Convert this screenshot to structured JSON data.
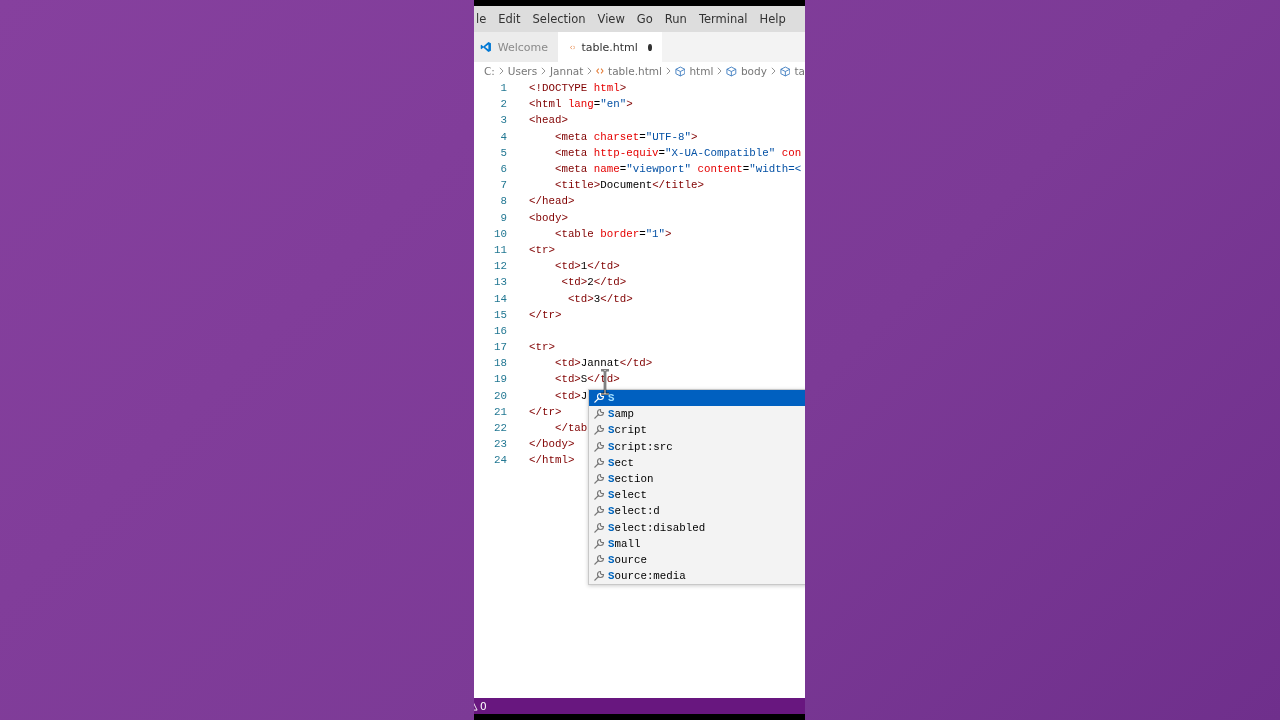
{
  "menu": [
    "le",
    "Edit",
    "Selection",
    "View",
    "Go",
    "Run",
    "Terminal",
    "Help"
  ],
  "tabs": [
    {
      "label": "Welcome",
      "kind": "welcome",
      "selected": false,
      "modified": false
    },
    {
      "label": "table.html",
      "kind": "html",
      "selected": true,
      "modified": true
    }
  ],
  "breadcrumb": [
    {
      "label": "C:",
      "kind": "folder"
    },
    {
      "label": "Users",
      "kind": "folder"
    },
    {
      "label": "Jannat",
      "kind": "folder"
    },
    {
      "label": "table.html",
      "kind": "html"
    },
    {
      "label": "html",
      "kind": "element"
    },
    {
      "label": "body",
      "kind": "element"
    },
    {
      "label": "ta",
      "kind": "element"
    }
  ],
  "editor": {
    "lines": [
      {
        "number": "1",
        "segments": [
          {
            "kind": "tag",
            "text": "<!DOCTYPE"
          },
          {
            "kind": "attr",
            "text": " html"
          },
          {
            "kind": "tag",
            "text": ">"
          }
        ]
      },
      {
        "number": "2",
        "segments": [
          {
            "kind": "tag",
            "text": "<html"
          },
          {
            "kind": "attr",
            "text": " lang"
          },
          {
            "kind": "plain",
            "text": "="
          },
          {
            "kind": "value",
            "text": "\"en\""
          },
          {
            "kind": "tag",
            "text": ">"
          }
        ]
      },
      {
        "number": "3",
        "segments": [
          {
            "kind": "tag",
            "text": "<head>"
          }
        ]
      },
      {
        "number": "4",
        "segments": [
          {
            "kind": "tag",
            "text": "    <meta"
          },
          {
            "kind": "attr",
            "text": " charset"
          },
          {
            "kind": "plain",
            "text": "="
          },
          {
            "kind": "value",
            "text": "\"UTF-8\""
          },
          {
            "kind": "tag",
            "text": ">"
          }
        ]
      },
      {
        "number": "5",
        "segments": [
          {
            "kind": "tag",
            "text": "    <meta"
          },
          {
            "kind": "attr",
            "text": " http-equiv"
          },
          {
            "kind": "plain",
            "text": "="
          },
          {
            "kind": "value",
            "text": "\"X-UA-Compatible\""
          },
          {
            "kind": "attr",
            "text": " con"
          }
        ]
      },
      {
        "number": "6",
        "segments": [
          {
            "kind": "tag",
            "text": "    <meta"
          },
          {
            "kind": "attr",
            "text": " name"
          },
          {
            "kind": "plain",
            "text": "="
          },
          {
            "kind": "value",
            "text": "\"viewport\""
          },
          {
            "kind": "attr",
            "text": " content"
          },
          {
            "kind": "plain",
            "text": "="
          },
          {
            "kind": "value",
            "text": "\"width=<"
          }
        ]
      },
      {
        "number": "7",
        "segments": [
          {
            "kind": "tag",
            "text": "    <title>"
          },
          {
            "kind": "plain",
            "text": "Document"
          },
          {
            "kind": "tag",
            "text": "</title>"
          }
        ]
      },
      {
        "number": "8",
        "segments": [
          {
            "kind": "tag",
            "text": "</head>"
          }
        ]
      },
      {
        "number": "9",
        "segments": [
          {
            "kind": "tag",
            "text": "<body>"
          }
        ]
      },
      {
        "number": "10",
        "segments": [
          {
            "kind": "tag",
            "text": "    <table"
          },
          {
            "kind": "attr",
            "text": " border"
          },
          {
            "kind": "plain",
            "text": "="
          },
          {
            "kind": "value",
            "text": "\"1\""
          },
          {
            "kind": "tag",
            "text": ">"
          }
        ]
      },
      {
        "number": "11",
        "segments": [
          {
            "kind": "tag",
            "text": "<tr>"
          }
        ]
      },
      {
        "number": "12",
        "segments": [
          {
            "kind": "tag",
            "text": "    <td>"
          },
          {
            "kind": "plain",
            "text": "1"
          },
          {
            "kind": "tag",
            "text": "</td>"
          }
        ]
      },
      {
        "number": "13",
        "segments": [
          {
            "kind": "tag",
            "text": "     <td>"
          },
          {
            "kind": "plain",
            "text": "2"
          },
          {
            "kind": "tag",
            "text": "</td>"
          }
        ]
      },
      {
        "number": "14",
        "segments": [
          {
            "kind": "tag",
            "text": "      <td>"
          },
          {
            "kind": "plain",
            "text": "3"
          },
          {
            "kind": "tag",
            "text": "</td>"
          }
        ]
      },
      {
        "number": "15",
        "segments": [
          {
            "kind": "tag",
            "text": "</tr>"
          }
        ]
      },
      {
        "number": "16"
      },
      {
        "number": "17",
        "segments": [
          {
            "kind": "tag",
            "text": "<tr>"
          }
        ]
      },
      {
        "number": "18",
        "segments": [
          {
            "kind": "tag",
            "text": "    <td>"
          },
          {
            "kind": "plain",
            "text": "Jannat"
          },
          {
            "kind": "tag",
            "text": "</td>"
          }
        ]
      },
      {
        "number": "19",
        "segments": [
          {
            "kind": "tag",
            "text": "    <td>"
          },
          {
            "kind": "plain",
            "text": "S"
          },
          {
            "kind": "tag",
            "text": "</td>"
          }
        ]
      },
      {
        "number": "20",
        "segments": [
          {
            "kind": "tag",
            "text": "    <td>"
          },
          {
            "kind": "plain",
            "text": "J"
          }
        ]
      },
      {
        "number": "21",
        "segments": [
          {
            "kind": "tag",
            "text": "</tr>"
          }
        ]
      },
      {
        "number": "22",
        "segments": [
          {
            "kind": "tag",
            "text": "    </tab"
          }
        ]
      },
      {
        "number": "23",
        "segments": [
          {
            "kind": "tag",
            "text": "</body>"
          }
        ]
      },
      {
        "number": "24",
        "segments": [
          {
            "kind": "tag",
            "text": "</html>"
          }
        ]
      }
    ],
    "suggestions": [
      {
        "label": "S",
        "selected": true
      },
      {
        "label": "Samp",
        "selected": false
      },
      {
        "label": "Script",
        "selected": false
      },
      {
        "label": "Script:src",
        "selected": false
      },
      {
        "label": "Sect",
        "selected": false
      },
      {
        "label": "Section",
        "selected": false
      },
      {
        "label": "Select",
        "selected": false
      },
      {
        "label": "Select:d",
        "selected": false
      },
      {
        "label": "Select:disabled",
        "selected": false
      },
      {
        "label": "Small",
        "selected": false
      },
      {
        "label": "Source",
        "selected": false
      },
      {
        "label": "Source:media",
        "selected": false
      }
    ]
  },
  "status_bar": {
    "warnings": "0"
  }
}
